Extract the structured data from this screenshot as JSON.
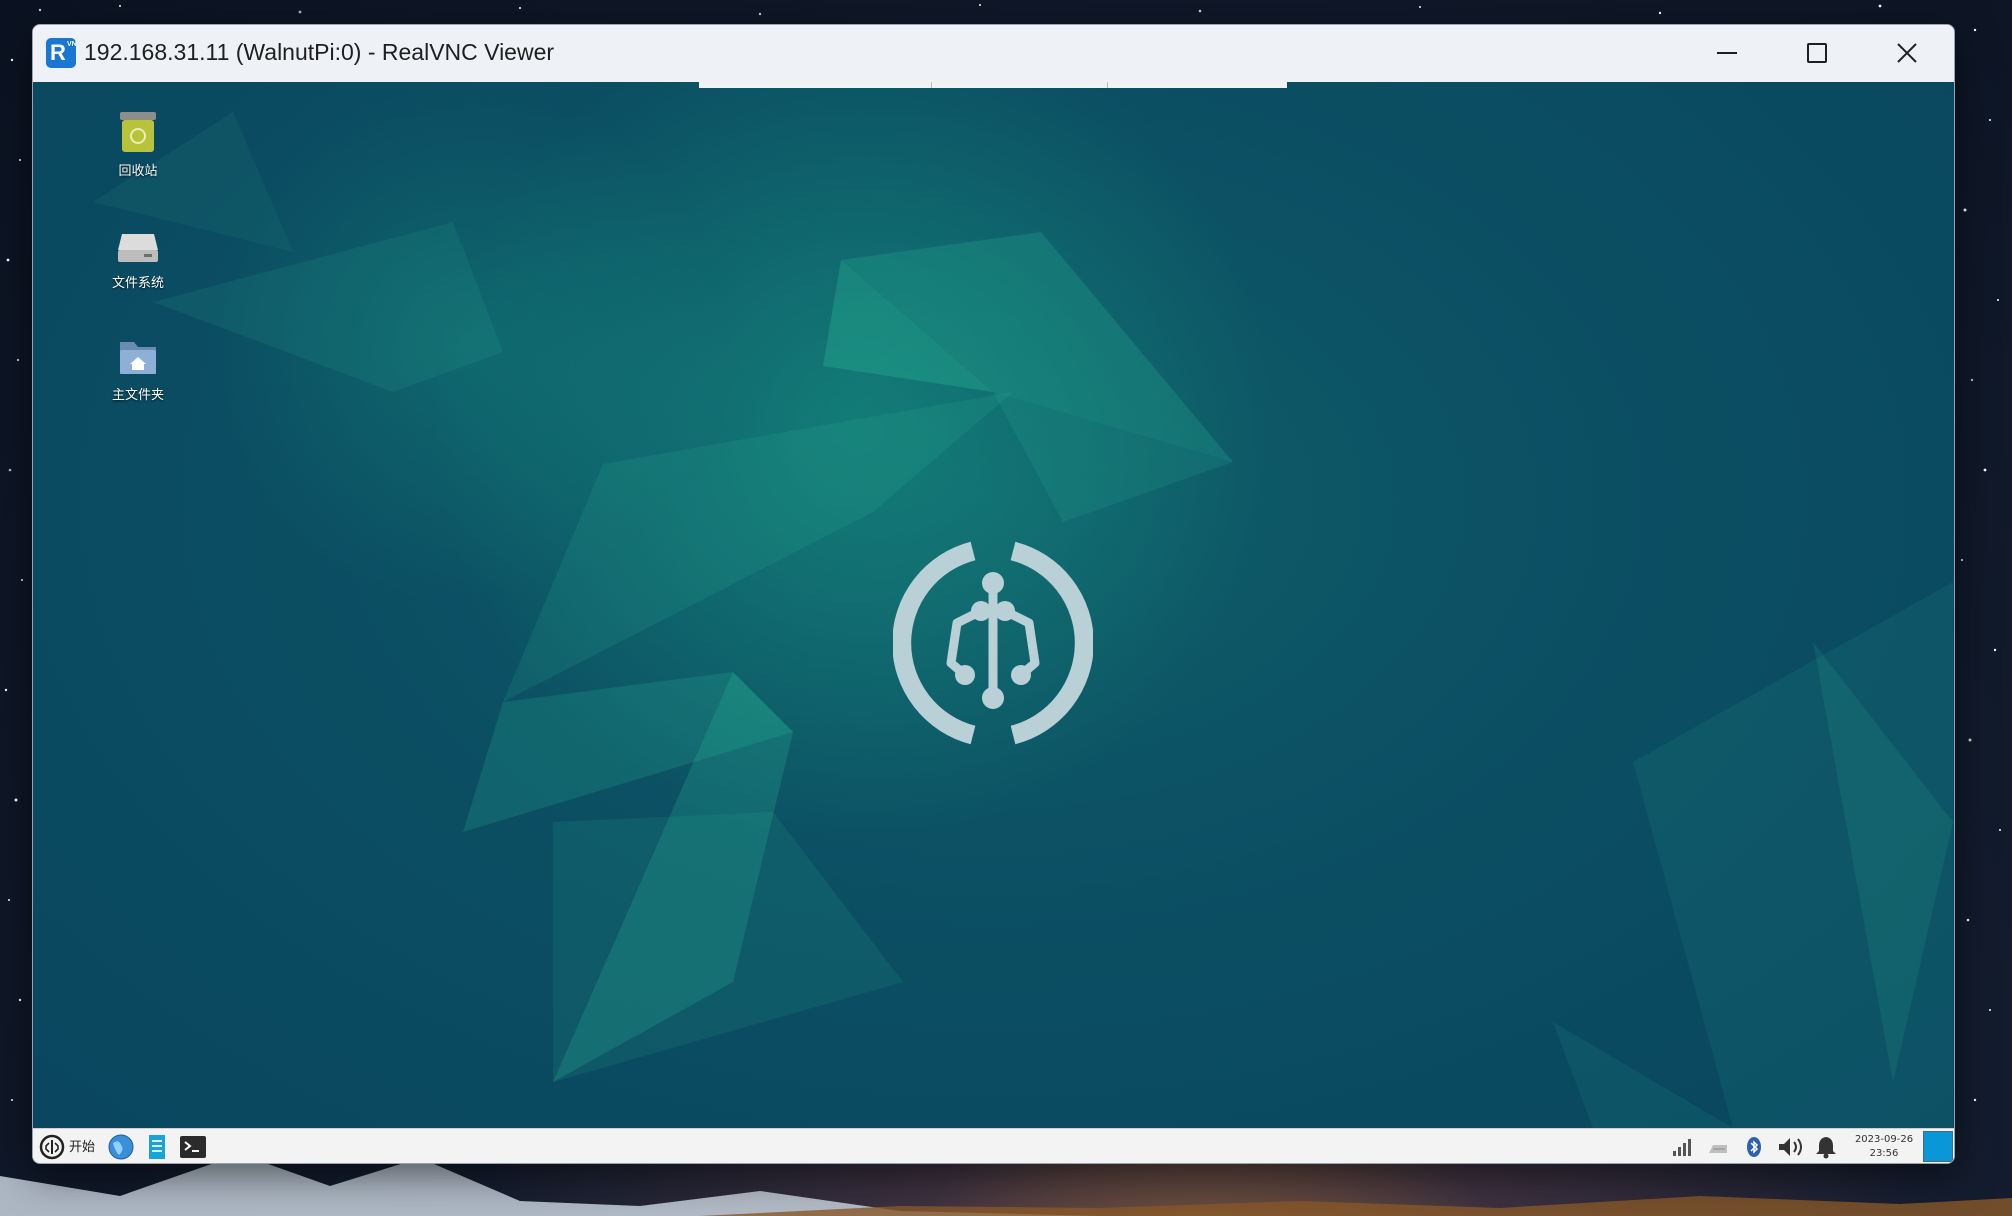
{
  "window": {
    "title": "192.168.31.11 (WalnutPi:0) - RealVNC Viewer",
    "app_icon_letter": "R",
    "app_icon_sub": "VNC",
    "app_icon_color": "#1976d2",
    "controls": [
      "minimize-icon",
      "maximize-icon",
      "close-icon"
    ]
  },
  "desktop": {
    "background_color": "#0a465f",
    "icons": [
      {
        "label": "回收站",
        "icon": "trash-icon"
      },
      {
        "label": "文件系统",
        "icon": "drive-icon"
      },
      {
        "label": "主文件夹",
        "icon": "home-folder-icon"
      }
    ],
    "center_logo": "walnutpi-logo-icon"
  },
  "taskbar": {
    "start_label": "开始",
    "launchers": [
      "browser-icon",
      "file-manager-icon",
      "terminal-icon"
    ],
    "tray": [
      "network-signal-icon",
      "keyboard-icon",
      "bluetooth-icon",
      "volume-icon",
      "notification-bell-icon"
    ],
    "clock_date": "2023-09-26",
    "clock_time": "23:56",
    "show_desktop_color": "#0a97d8"
  }
}
